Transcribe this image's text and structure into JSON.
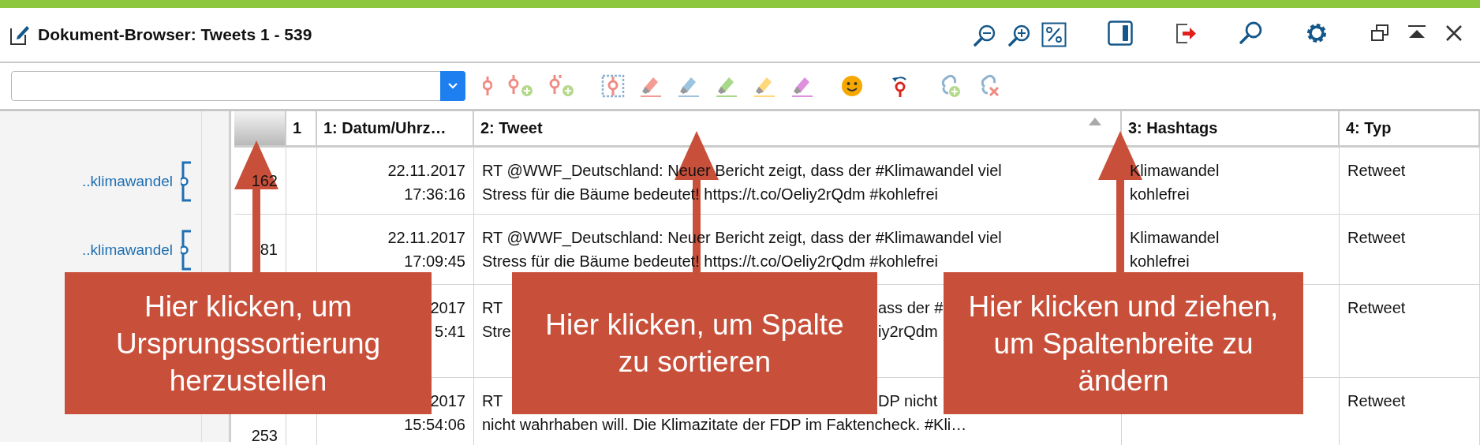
{
  "window": {
    "title": "Dokument-Browser: Tweets 1 - 539"
  },
  "code_margin": [
    {
      "label": "..klimawandel"
    },
    {
      "label": "..klimawandel"
    }
  ],
  "table": {
    "columns": [
      {
        "label": "1",
        "sorted": false
      },
      {
        "label": "1: Datum/Uhrz…",
        "sorted": false
      },
      {
        "label": "2: Tweet",
        "sorted": true
      },
      {
        "label": "3: Hashtags",
        "sorted": false
      },
      {
        "label": "4: Typ",
        "sorted": false
      }
    ],
    "rows": [
      {
        "number": "162",
        "date": [
          [
            "22.11.2017"
          ],
          [
            "17:36:16"
          ]
        ],
        "tweet": [
          [
            "RT @WWF_Deutschland: Neuer Bericht zeigt, dass der #Klimawandel viel"
          ],
          [
            "Stress für die Bäume bedeutet! https://t.co/Oeliy2rQdm #kohlefrei"
          ]
        ],
        "hashtags": [
          [
            "Klimawandel"
          ],
          [
            "kohlefrei"
          ]
        ],
        "type": [
          [
            "Retweet"
          ]
        ]
      },
      {
        "number": "81",
        "date": [
          [
            "22.11.2017"
          ],
          [
            "17:09:45"
          ]
        ],
        "tweet": [
          [
            "RT @WWF_Deutschland: Neuer Bericht zeigt, dass der #Klimawandel viel"
          ],
          [
            "Stress für die Bäume bedeutet! https://t.co/Oeliy2rQdm #kohlefrei"
          ]
        ],
        "hashtags": [
          [
            "Klimawandel"
          ],
          [
            "kohlefrei"
          ]
        ],
        "type": [
          [
            "Retweet"
          ]
        ]
      },
      {
        "date": [
          [
            "2017"
          ],
          [
            "5:41"
          ]
        ],
        "tweet": [
          [
            "RT",
            "ass der #"
          ],
          [
            "Stre",
            "iy2rQdm"
          ]
        ],
        "type": [
          [
            "Retweet"
          ]
        ]
      },
      {
        "number": "253",
        "date": [
          [
            "2017"
          ],
          [
            "15:54:06"
          ]
        ],
        "tweet": [
          [
            "RT",
            "DP nicht"
          ],
          [
            "nicht wahrhaben will. Die Klimazitate der FDP im Faktencheck. #Kli…"
          ]
        ],
        "type": [
          [
            "Retweet"
          ]
        ]
      }
    ]
  },
  "callouts": [
    {
      "text": "Hier klicken, um Ursprungssortierung herzustellen"
    },
    {
      "text": "Hier klicken, um Spalte zu sortieren"
    },
    {
      "text": "Hier klicken und ziehen, um Spaltenbreite zu ändern"
    }
  ]
}
